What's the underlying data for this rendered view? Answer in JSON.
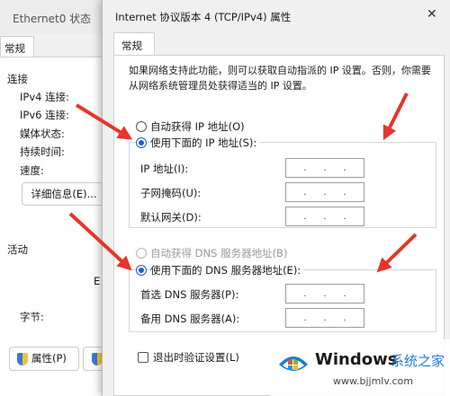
{
  "background_window": {
    "title": "Ethernet0 状态",
    "tab": "常规",
    "section_connection": "连接",
    "rows": [
      "IPv4 连接:",
      "IPv6 连接:",
      "媒体状态:",
      "持续时间:",
      "速度:"
    ],
    "details_button": "详细信息(E)...",
    "section_activity": "活动",
    "activity_fragment": "E",
    "bytes_label": "字节:",
    "properties_button": "属性(P)"
  },
  "dialog": {
    "title": "Internet 协议版本 4 (TCP/IPv4) 属性",
    "close_glyph": "✕",
    "tab": "常规",
    "description": "如果网络支持此功能，则可以获取自动指派的 IP 设置。否则，你需要从网络系统管理员处获得适当的 IP 设置。",
    "auto_ip": "自动获得 IP 地址(O)",
    "manual_ip": "使用下面的 IP 地址(S):",
    "ip_fields": {
      "ip_address": "IP 地址(I):",
      "subnet_mask": "子网掩码(U):",
      "default_gateway": "默认网关(D):"
    },
    "auto_dns": "自动获得 DNS 服务器地址(B)",
    "manual_dns": "使用下面的 DNS 服务器地址(E):",
    "dns_fields": {
      "preferred": "首选 DNS 服务器(P):",
      "alternate": "备用 DNS 服务器(A):"
    },
    "ip_dots": ".",
    "validate_on_exit": "退出时验证设置(L)",
    "selected": {
      "ip_mode": "manual",
      "dns_mode": "manual",
      "validate_on_exit": false
    }
  },
  "watermark": {
    "brand": "Windows",
    "brand_cn": "系统之家",
    "url": "www.bjjmlv.com"
  },
  "colors": {
    "arrow": "#e8342a",
    "accent": "#1c5fc7"
  }
}
